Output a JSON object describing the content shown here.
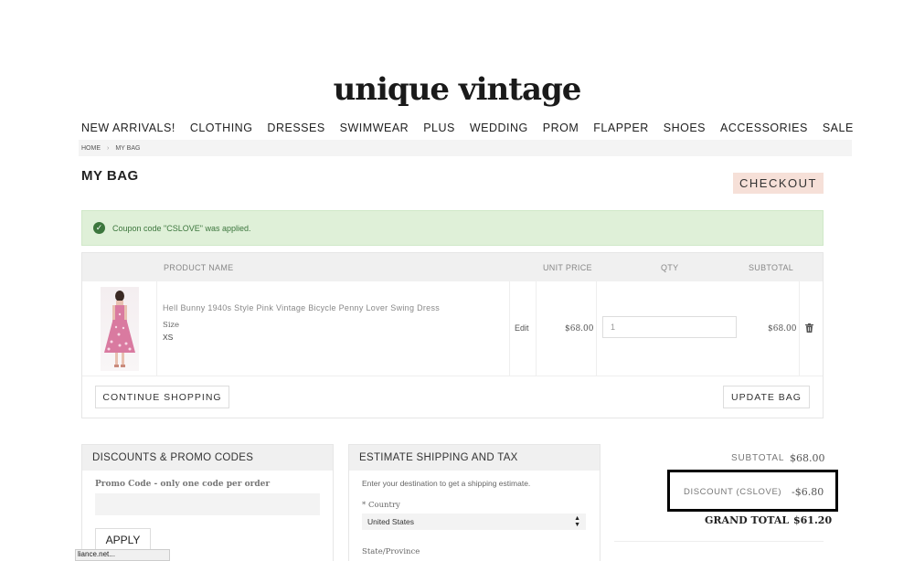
{
  "brand": {
    "logo_text": "unique vintage"
  },
  "nav": {
    "items": [
      "NEW ARRIVALS!",
      "CLOTHING",
      "DRESSES",
      "SWIMWEAR",
      "PLUS",
      "WEDDING",
      "PROM",
      "FLAPPER",
      "SHOES",
      "ACCESSORIES",
      "SALE"
    ]
  },
  "breadcrumb": {
    "home": "HOME",
    "separator": "›",
    "current": "MY BAG"
  },
  "page": {
    "title": "MY BAG",
    "checkout_label": "CHECKOUT"
  },
  "message": {
    "text": "Coupon code \"CSLOVE\" was applied.",
    "icon": "check-circle-icon"
  },
  "cart": {
    "headers": {
      "product": "PRODUCT NAME",
      "unit_price": "UNIT PRICE",
      "qty": "QTY",
      "subtotal": "SUBTOTAL"
    },
    "item": {
      "name": "Hell Bunny 1940s Style Pink Vintage Bicycle Penny Lover Swing Dress",
      "size_label": "Size",
      "size_value": "XS",
      "edit_label": "Edit",
      "unit_price": "$68.00",
      "qty": "1",
      "subtotal": "$68.00",
      "remove_icon": "trash-icon"
    },
    "continue_label": "CONTINUE SHOPPING",
    "update_label": "UPDATE BAG"
  },
  "discounts": {
    "title": "DISCOUNTS & PROMO CODES",
    "promo_label": "Promo Code - only one code per order",
    "apply_label": "APPLY"
  },
  "shipping": {
    "title": "ESTIMATE SHIPPING AND TAX",
    "description": "Enter your destination to get a shipping estimate.",
    "country_label": "* Country",
    "country_value": "United States",
    "state_label": "State/Province"
  },
  "totals": {
    "subtotal_label": "SUBTOTAL",
    "subtotal_value": "$68.00",
    "discount_label": "DISCOUNT (CSLOVE)",
    "discount_value": "-$6.80",
    "grand_label": "GRAND TOTAL",
    "grand_value": "$61.20"
  },
  "status_bar": {
    "text": "liance.net..."
  },
  "colors": {
    "checkout_bg": "#f6e0d8",
    "success_bg": "#dff0d8",
    "success_text": "#3c763d",
    "highlight_border": "#000000"
  }
}
